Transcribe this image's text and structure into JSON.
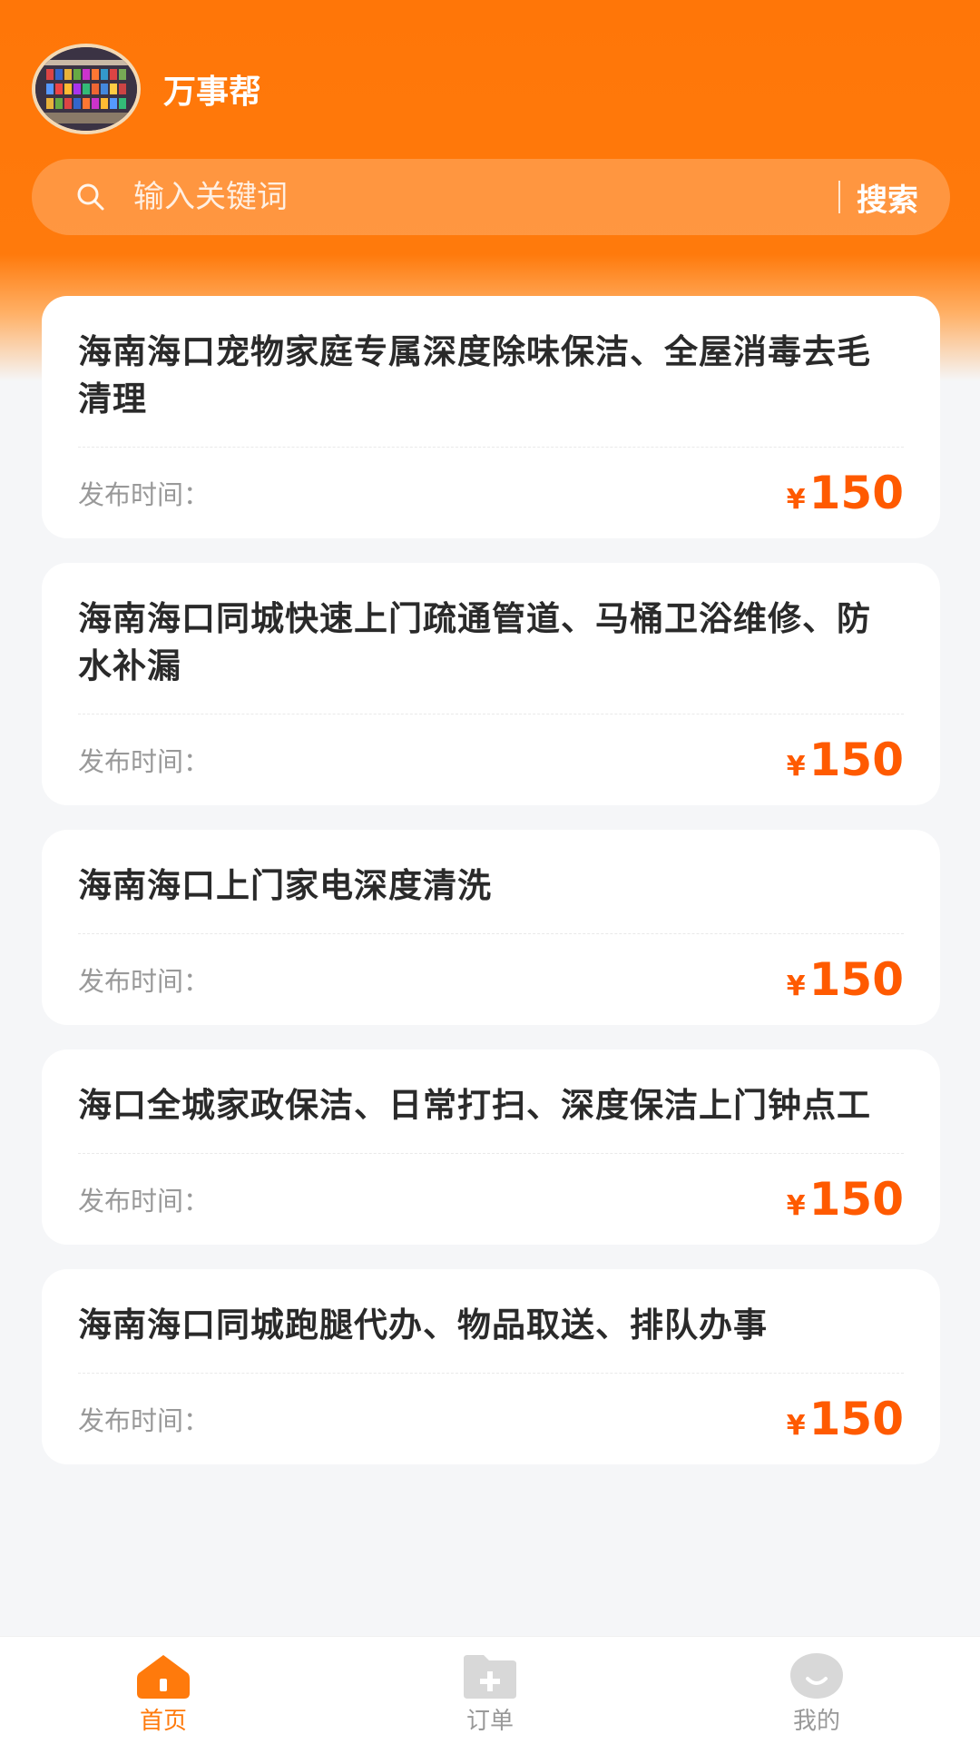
{
  "brand": {
    "app_name": "万事帮",
    "avatar_icon": "storefront-avatar"
  },
  "search": {
    "placeholder": "输入关键词",
    "button_label": "搜索"
  },
  "listings": [
    {
      "title": "海南海口宠物家庭专属深度除味保洁、全屋消毒去毛清理",
      "publish_label": "发布时间：",
      "currency": "¥",
      "price": "150"
    },
    {
      "title": "海南海口同城快速上门疏通管道、马桶卫浴维修、防水补漏",
      "publish_label": "发布时间：",
      "currency": "¥",
      "price": "150"
    },
    {
      "title": "海南海口上门家电深度清洗",
      "publish_label": "发布时间：",
      "currency": "¥",
      "price": "150"
    },
    {
      "title": "海口全城家政保洁、日常打扫、深度保洁上门钟点工",
      "publish_label": "发布时间：",
      "currency": "¥",
      "price": "150"
    },
    {
      "title": "海南海口同城跑腿代办、物品取送、排队办事",
      "publish_label": "发布时间：",
      "currency": "¥",
      "price": "150"
    }
  ],
  "tabbar": {
    "items": [
      {
        "label": "首页",
        "icon": "home-icon",
        "active": true
      },
      {
        "label": "订单",
        "icon": "folder-add-icon",
        "active": false
      },
      {
        "label": "我的",
        "icon": "profile-icon",
        "active": false
      }
    ]
  },
  "colors": {
    "accent": "#ff7a0c",
    "price": "#ff5a00",
    "background": "#f5f6f8",
    "inactive_tab": "#d0d0d0"
  }
}
